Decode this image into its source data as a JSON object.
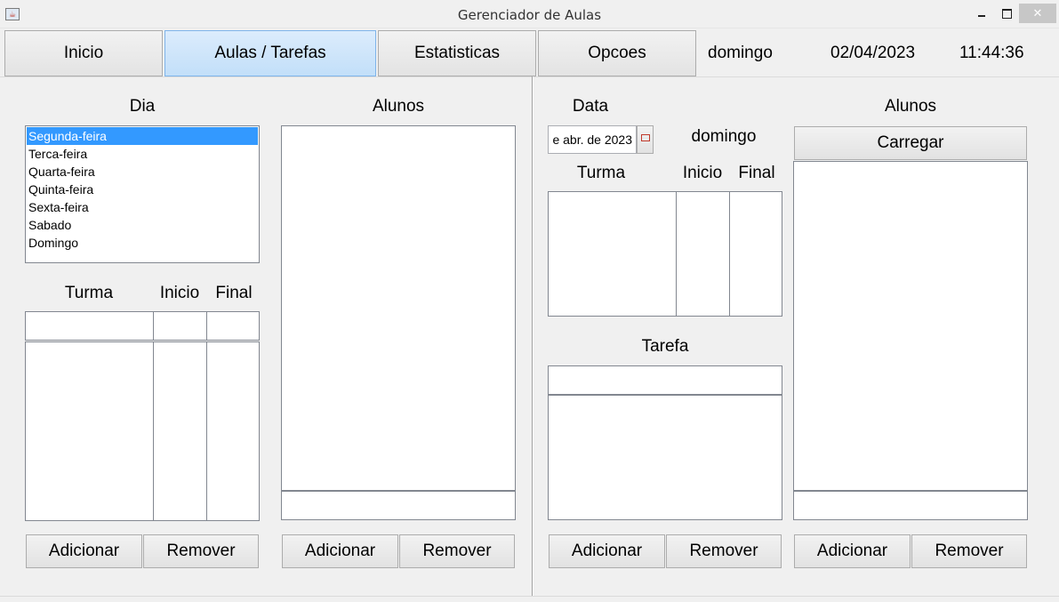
{
  "window": {
    "title": "Gerenciador de Aulas",
    "controls": {
      "minimize": "",
      "maximize": "",
      "close": "✕"
    }
  },
  "tabs": [
    {
      "label": "Inicio"
    },
    {
      "label": "Aulas / Tarefas",
      "active": true
    },
    {
      "label": "Estatisticas"
    },
    {
      "label": "Opcoes"
    }
  ],
  "header": {
    "weekday": "domingo",
    "date": "02/04/2023",
    "time": "11:44:36"
  },
  "left": {
    "dia_label": "Dia",
    "days": [
      "Segunda-feira",
      "Terca-feira",
      "Quarta-feira",
      "Quinta-feira",
      "Sexta-feira",
      "Sabado",
      "Domingo"
    ],
    "selected_day": "Segunda-feira",
    "cols": {
      "turma": "Turma",
      "inicio": "Inicio",
      "final": "Final"
    },
    "add_label": "Adicionar",
    "remove_label": "Remover",
    "alunos_label": "Alunos",
    "alunos_add_label": "Adicionar",
    "alunos_remove_label": "Remover"
  },
  "right": {
    "data_label": "Data",
    "date_value": "e abr. de 2023",
    "weekday": "domingo",
    "cols": {
      "turma": "Turma",
      "inicio": "Inicio",
      "final": "Final"
    },
    "tarefa_label": "Tarefa",
    "add_label": "Adicionar",
    "remove_label": "Remover",
    "alunos_label": "Alunos",
    "carregar_label": "Carregar",
    "alunos_add_label": "Adicionar",
    "alunos_remove_label": "Remover"
  },
  "colors": {
    "selection": "#3399ff",
    "active_tab": "#c2dff9"
  }
}
